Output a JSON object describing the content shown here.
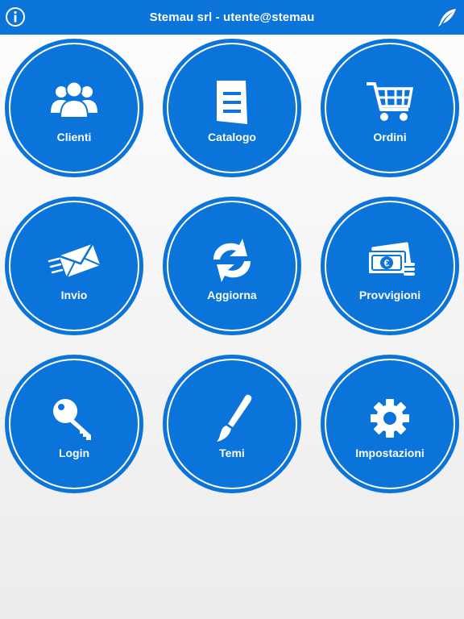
{
  "header": {
    "title": "Stemau srl - utente@stemau",
    "info_icon": "info-icon",
    "logo_icon": "feather-logo-icon"
  },
  "colors": {
    "primary": "#0a74da",
    "text": "#ffffff"
  },
  "tiles": [
    {
      "label": "Clienti",
      "icon": "users-icon"
    },
    {
      "label": "Catalogo",
      "icon": "catalog-icon"
    },
    {
      "label": "Ordini",
      "icon": "cart-icon"
    },
    {
      "label": "Invio",
      "icon": "send-mail-icon"
    },
    {
      "label": "Aggiorna",
      "icon": "refresh-icon"
    },
    {
      "label": "Provvigioni",
      "icon": "money-icon"
    },
    {
      "label": "Login",
      "icon": "key-icon"
    },
    {
      "label": "Temi",
      "icon": "brush-icon"
    },
    {
      "label": "Impostazioni",
      "icon": "gear-icon"
    }
  ]
}
